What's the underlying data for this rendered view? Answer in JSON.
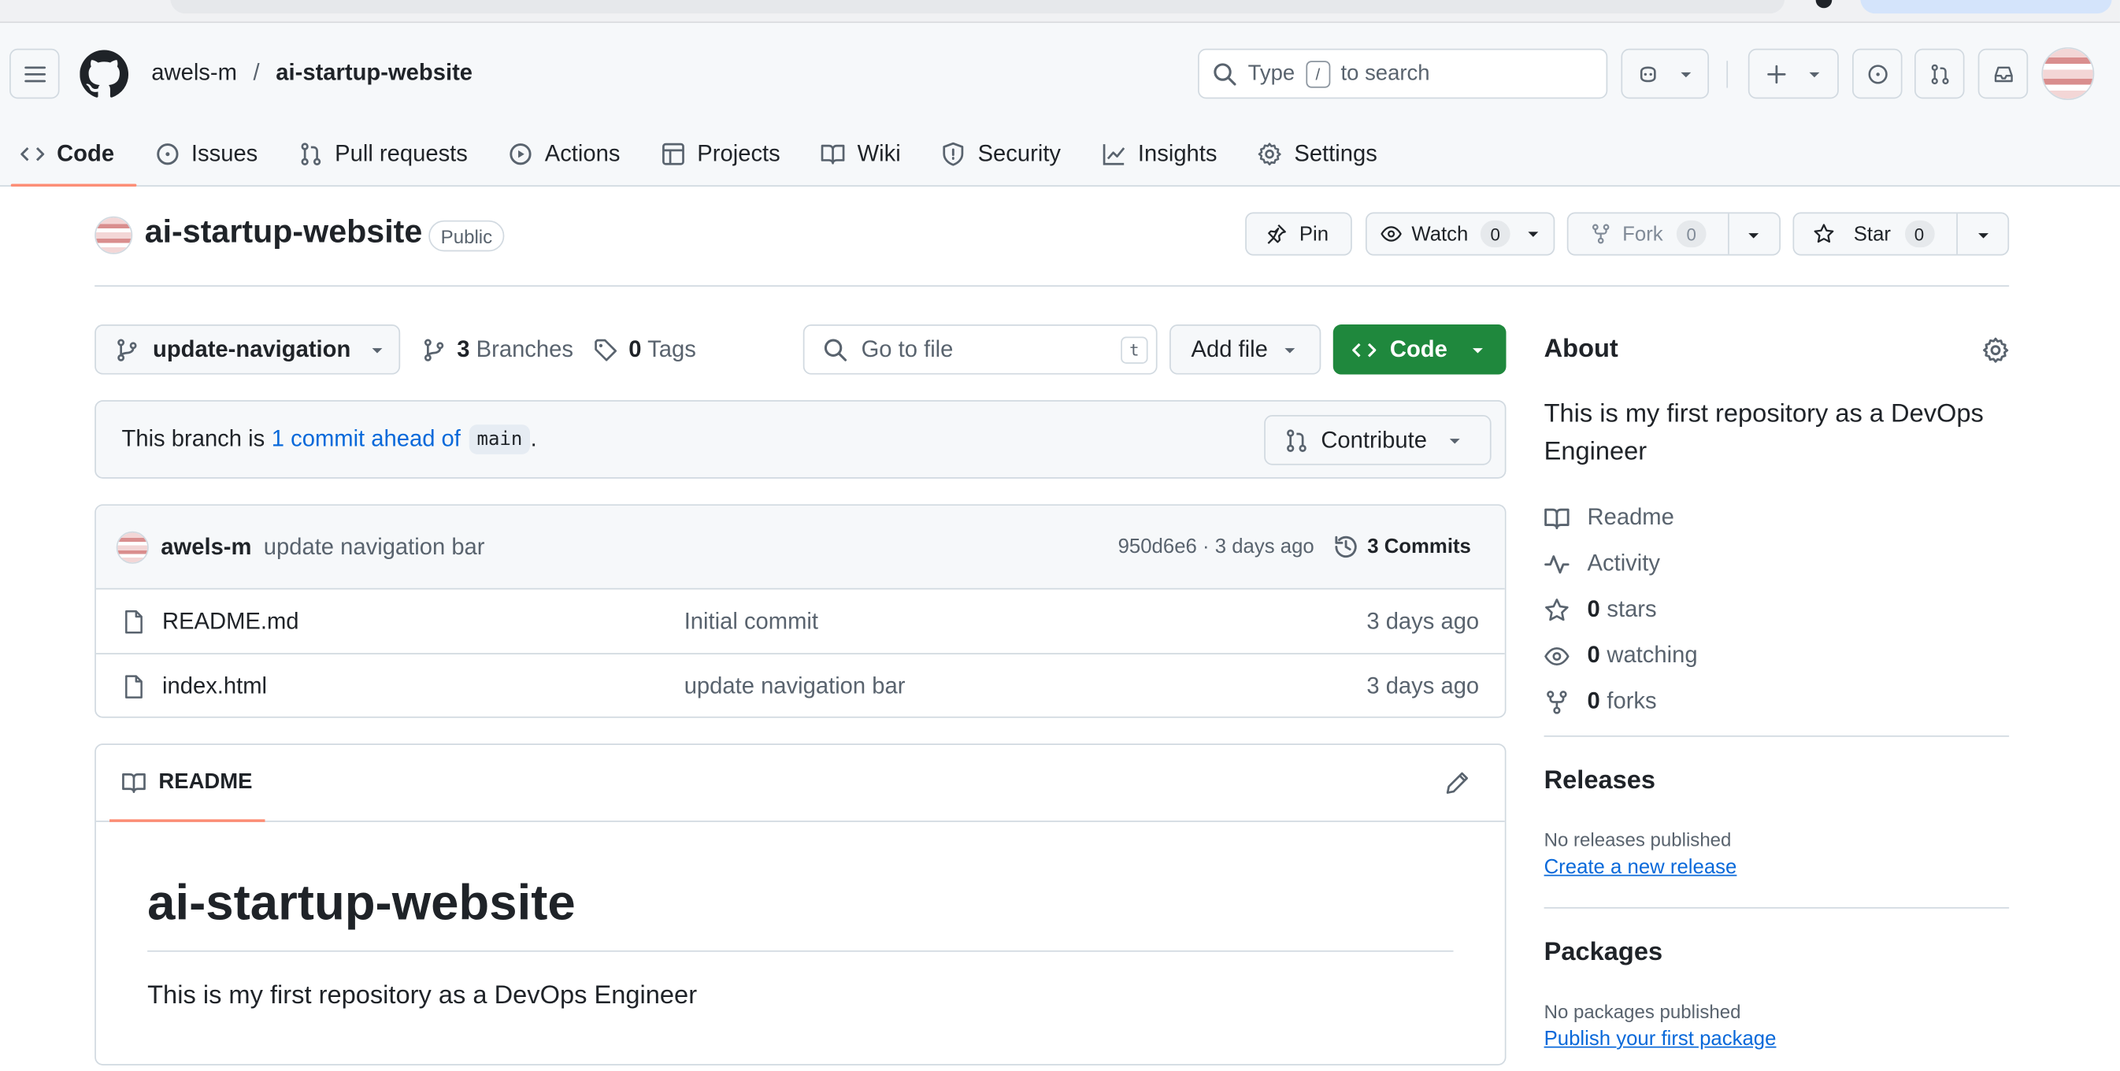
{
  "header": {
    "owner": "awels-m",
    "separator": "/",
    "repo": "ai-startup-website",
    "search_prefix": "Type",
    "search_key": "/",
    "search_suffix": "to search"
  },
  "tabs": [
    {
      "label": "Code",
      "icon": "code-icon"
    },
    {
      "label": "Issues",
      "icon": "issue-icon"
    },
    {
      "label": "Pull requests",
      "icon": "pull-request-icon"
    },
    {
      "label": "Actions",
      "icon": "play-icon"
    },
    {
      "label": "Projects",
      "icon": "table-icon"
    },
    {
      "label": "Wiki",
      "icon": "book-icon"
    },
    {
      "label": "Security",
      "icon": "shield-icon"
    },
    {
      "label": "Insights",
      "icon": "graph-icon"
    },
    {
      "label": "Settings",
      "icon": "gear-icon"
    }
  ],
  "repo_head": {
    "name": "ai-startup-website",
    "visibility": "Public",
    "pin_label": "Pin",
    "watch_label": "Watch",
    "watch_count": "0",
    "fork_label": "Fork",
    "fork_count": "0",
    "star_label": "Star",
    "star_count": "0"
  },
  "toolbar": {
    "branch": "update-navigation",
    "branches_count": "3",
    "branches_label": "Branches",
    "tags_count": "0",
    "tags_label": "Tags",
    "goto_placeholder": "Go to file",
    "goto_key": "t",
    "add_file_label": "Add file",
    "code_label": "Code"
  },
  "ahead": {
    "prefix": "This branch is",
    "link": "1 commit ahead of",
    "base": "main",
    "suffix": ".",
    "contribute_label": "Contribute"
  },
  "latest_commit": {
    "author": "awels-m",
    "message": "update navigation bar",
    "sha_time": "950d6e6 · 3 days ago",
    "commits_label": "3 Commits"
  },
  "files": [
    {
      "name": "README.md",
      "message": "Initial commit",
      "date": "3 days ago"
    },
    {
      "name": "index.html",
      "message": "update navigation bar",
      "date": "3 days ago"
    }
  ],
  "readme": {
    "tab_label": "README",
    "heading": "ai-startup-website",
    "text": "This is my first repository as a DevOps Engineer"
  },
  "about": {
    "title": "About",
    "description": "This is my first repository as a DevOps Engineer",
    "readme": "Readme",
    "activity": "Activity",
    "stars_count": "0",
    "stars_label": "stars",
    "watching_count": "0",
    "watching_label": "watching",
    "forks_count": "0",
    "forks_label": "forks"
  },
  "releases": {
    "title": "Releases",
    "empty": "No releases published",
    "link": "Create a new release"
  },
  "packages": {
    "title": "Packages",
    "empty": "No packages published",
    "link": "Publish your first package"
  },
  "colors": {
    "accent_green": "#1f883d",
    "link_blue": "#0969da",
    "tab_underline": "#fd8c73"
  }
}
